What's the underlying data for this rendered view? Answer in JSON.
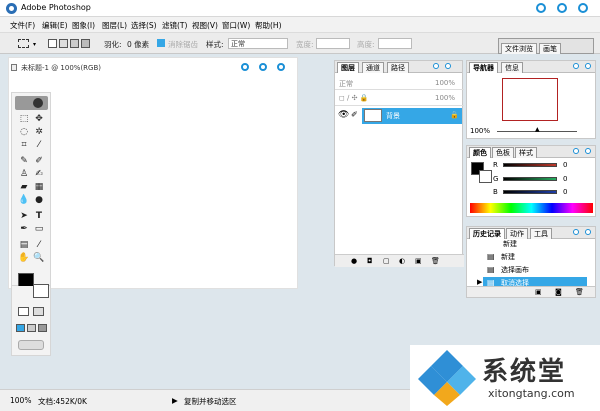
{
  "app": {
    "title": "Adobe Photoshop"
  },
  "menu": [
    "文件(F)",
    "编辑(E)",
    "图象(I)",
    "图层(L)",
    "选择(S)",
    "滤镜(T)",
    "视图(V)",
    "窗口(W)",
    "帮助(H)"
  ],
  "options": {
    "feather_label": "羽化:",
    "feather_value": "0 像素",
    "antialias_label": "消除锯齿",
    "style_label": "样式:",
    "style_value": "正常",
    "width_label": "宽度:",
    "height_label": "高度:",
    "tab_file_browser": "文件浏览",
    "tab_brushes": "画笔"
  },
  "document": {
    "title": "未标题-1 @ 100%(RGB)"
  },
  "layers_panel": {
    "tabs": [
      "图层",
      "通道",
      "路径"
    ],
    "mode": "正常",
    "opacity": "100%",
    "fill": "100%",
    "layer_name": "背景"
  },
  "navigator_panel": {
    "tabs": [
      "导航器",
      "信息"
    ],
    "zoom": "100%",
    "frame_color": "#b22222"
  },
  "color_panel": {
    "tabs": [
      "颜色",
      "色板",
      "样式"
    ],
    "channels": [
      {
        "label": "R",
        "value": "0",
        "color": "#c0392b"
      },
      {
        "label": "G",
        "value": "0",
        "color": "#27ae60"
      },
      {
        "label": "B",
        "value": "0",
        "color": "#1f3fa8"
      }
    ]
  },
  "history_panel": {
    "tabs": [
      "历史记录",
      "动作",
      "工具"
    ],
    "items": [
      "新建",
      "新建",
      "选择画布",
      "取消选择"
    ],
    "active_color": "#35a7e6"
  },
  "status": {
    "zoom": "100%",
    "doc_info": "文档:452K/0K",
    "hint": "复制并移动选区"
  },
  "watermark": {
    "brand": "系统堂",
    "url": "xitongtang.com"
  },
  "colors": {
    "accent": "#1a8fd6",
    "workspace": "#dde6ec"
  }
}
